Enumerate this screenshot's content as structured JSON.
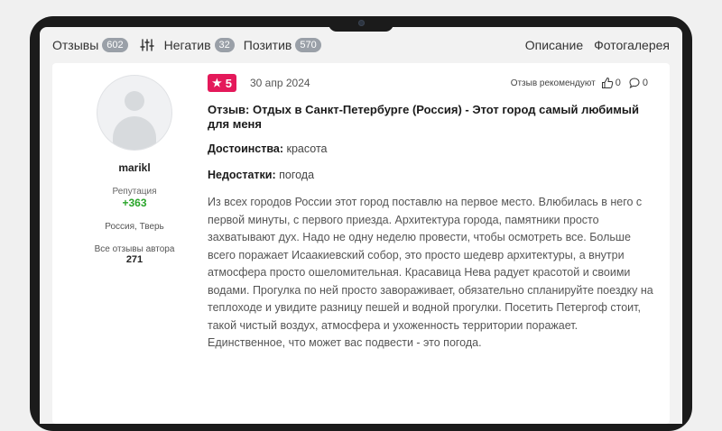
{
  "tabs": {
    "reviews": {
      "label": "Отзывы",
      "count": "602"
    },
    "negative": {
      "label": "Негатив",
      "count": "32"
    },
    "positive": {
      "label": "Позитив",
      "count": "570"
    },
    "description": "Описание",
    "gallery": "Фотогалерея"
  },
  "author": {
    "username": "marikl",
    "reputation_label": "Репутация",
    "reputation_value": "+363",
    "location": "Россия, Тверь",
    "all_reviews_label": "Все отзывы автора",
    "all_reviews_count": "271"
  },
  "review": {
    "rating": "5",
    "date": "30 апр 2024",
    "recommended_label": "Отзыв рекомендуют",
    "likes": "0",
    "comments": "0",
    "title": "Отзыв: Отдых в Санкт-Петербурге (Россия) - Этот город самый любимый для меня",
    "pros_label": "Достоинства:",
    "pros_value": "красота",
    "cons_label": "Недостатки:",
    "cons_value": "погода",
    "text": "Из всех городов России этот город поставлю на первое место. Влюбилась в него с первой минуты, с первого приезда. Архитектура города, памятники просто захватывают дух. Надо не одну неделю провести, чтобы осмотреть все. Больше всего поражает Исаакиевский собор, это просто шедевр архитектуры, а внутри атмосфера просто ошеломительная. Красавица Нева радует красотой и своими водами. Прогулка по ней просто завораживает, обязательно спланируйте поездку на теплоходе и увидите разницу пешей и водной прогулки. Посетить Петергоф стоит, такой чистый воздух, атмосфера и ухоженность территории поражает. Единственное, что может вас подвести - это погода."
  },
  "colors": {
    "rating_badge": "#e4195a",
    "reputation": "#2aa52a",
    "count_badge": "#9aa0a8"
  },
  "icons": [
    "star-icon",
    "filter-icon",
    "thumbs-up-icon",
    "comment-icon"
  ]
}
